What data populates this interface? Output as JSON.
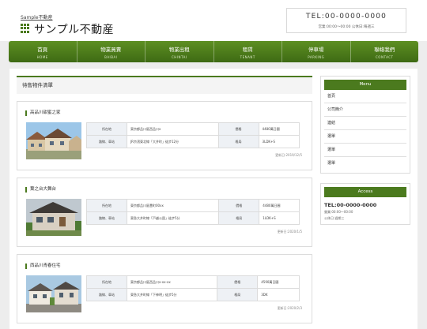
{
  "header": {
    "tag": "Sample不動産",
    "name": "サンプル不動産",
    "tel": "TEL:00-0000-0000",
    "hours": "営業:00:00〜00:00  公休日:毎週三"
  },
  "nav": [
    {
      "jp": "首頁",
      "en": "HOME"
    },
    {
      "jp": "物業買賣",
      "en": "BAIBAI"
    },
    {
      "jp": "物業出租",
      "en": "CHINTAI"
    },
    {
      "jp": "租賃",
      "en": "TENANT"
    },
    {
      "jp": "停車場",
      "en": "PARKING"
    },
    {
      "jp": "聯絡我們",
      "en": "CONTACT"
    }
  ],
  "main": {
    "section_title": "待售物件清單",
    "properties": [
      {
        "title": "高品川甜蜜之家",
        "rows": [
          {
            "l1": "所在地",
            "v1": "東京都品川區西品川x",
            "l2": "價格",
            "v2": "4480萬日圓"
          },
          {
            "l1": "路線、車站",
            "v1": "JR京濱東北線「大井町」徒步12分",
            "l2": "格局",
            "v2": "3LDK+S"
          }
        ],
        "updated": "更新日:2019/12/5"
      },
      {
        "title": "葉之台大舞台",
        "rows": [
          {
            "l1": "所在地",
            "v1": "東京都品川區豊町00xx",
            "l2": "價格",
            "v2": "4480萬日圓"
          },
          {
            "l1": "路線、車站",
            "v1": "東急大井町線「戸越公園」徒步5分",
            "l2": "格局",
            "v2": "1LDK+S"
          }
        ],
        "updated": "更新日:2020/1/5"
      },
      {
        "title": "西品川青春住宅",
        "rows": [
          {
            "l1": "所在地",
            "v1": "東京都品川區西品川x-xx-xx",
            "l2": "價格",
            "v2": "4590萬日圓"
          },
          {
            "l1": "路線、車站",
            "v1": "東急大井町線「下神明」徒步5分",
            "l2": "格局",
            "v2": "3DK"
          }
        ],
        "updated": "更新日:2020/2/3"
      }
    ]
  },
  "sidebar": {
    "menu_title": "Menu",
    "menu": [
      "首頁",
      "公司簡介",
      "連結",
      "選單",
      "選單",
      "選單"
    ],
    "access_title": "Access",
    "access_tel": "TEL:00-0000-0000",
    "access_hours": "營業:00:00〜00:00",
    "access_holiday": "公休日:週期三"
  }
}
